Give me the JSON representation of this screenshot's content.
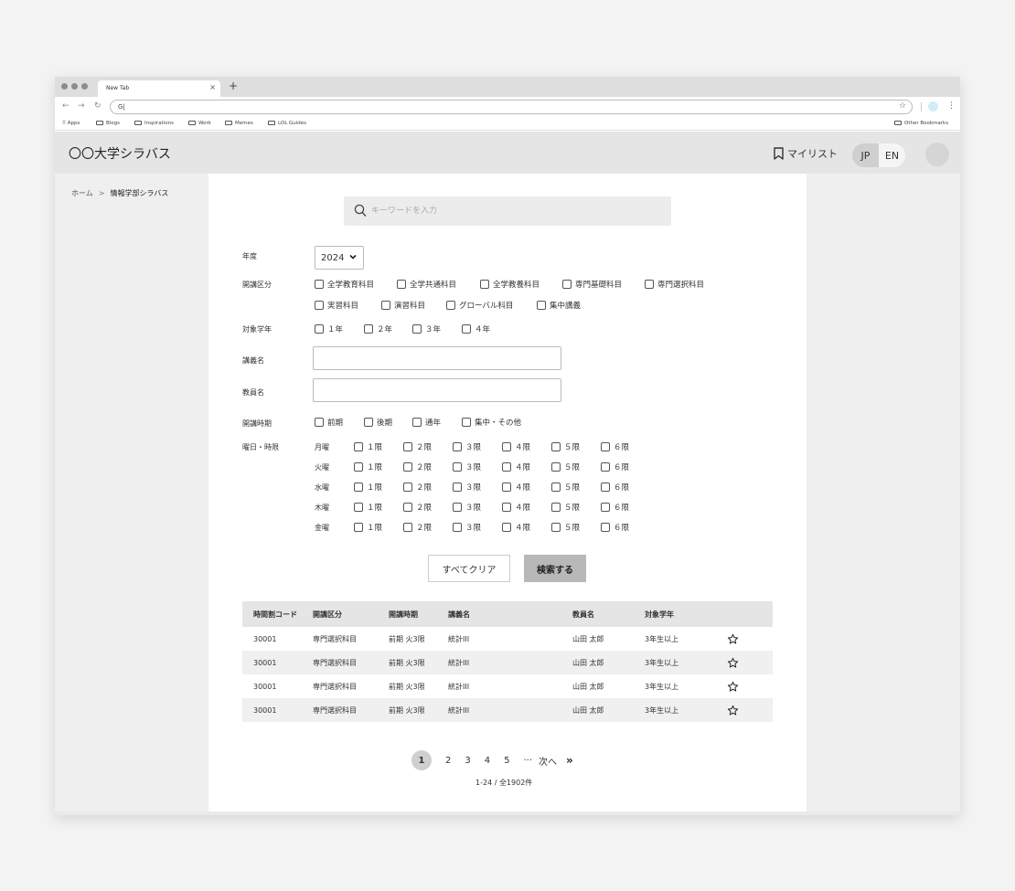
{
  "browser": {
    "tab_title": "New Tab",
    "tab_close": "×",
    "new_tab": "+",
    "url": "G|",
    "bookmarks": [
      "Apps",
      "Blogs",
      "Inspirations",
      "Work",
      "Memes",
      "LOL Guides"
    ],
    "other_bookmarks": "Other Bookmarks"
  },
  "header": {
    "site_title": "〇〇大学シラバス",
    "mylist_label": "マイリスト",
    "lang_jp": "JP",
    "lang_en": "EN"
  },
  "breadcrumb": {
    "home": "ホーム",
    "separator": ">",
    "current": "情報学部シラバス"
  },
  "search": {
    "placeholder": "キーワードを入力"
  },
  "filters": {
    "year_label": "年度",
    "year_value": "2024",
    "category_label": "開講区分",
    "categories": [
      "全学教育科目",
      "全学共通科目",
      "全学教養科目",
      "専門基礎科目",
      "専門選択科目",
      "実習科目",
      "演習科目",
      "グローバル科目",
      "集中講義"
    ],
    "grade_label": "対象学年",
    "grades": [
      "１年",
      "２年",
      "３年",
      "４年"
    ],
    "course_name_label": "講義名",
    "instructor_label": "教員名",
    "term_label": "開講時期",
    "terms": [
      "前期",
      "後期",
      "通年",
      "集中・その他"
    ],
    "dayperiod_label": "曜日・時限",
    "days": [
      "月曜",
      "火曜",
      "水曜",
      "木曜",
      "金曜"
    ],
    "periods": [
      "１限",
      "２限",
      "３限",
      "４限",
      "５限",
      "６限"
    ]
  },
  "actions": {
    "clear": "すべてクリア",
    "search": "検索する"
  },
  "results": {
    "columns": [
      "時間割コード",
      "開講区分",
      "開講時期",
      "講義名",
      "教員名",
      "対象学年"
    ],
    "rows": [
      [
        "30001",
        "専門選択科目",
        "前期 火3限",
        "統計III",
        "山田 太郎",
        "3年生以上"
      ],
      [
        "30001",
        "専門選択科目",
        "前期 火3限",
        "統計III",
        "山田 太郎",
        "3年生以上"
      ],
      [
        "30001",
        "専門選択科目",
        "前期 火3限",
        "統計III",
        "山田 太郎",
        "3年生以上"
      ],
      [
        "30001",
        "専門選択科目",
        "前期 火3限",
        "統計III",
        "山田 太郎",
        "3年生以上"
      ]
    ]
  },
  "pagination": {
    "pages": [
      "1",
      "2",
      "3",
      "4",
      "5"
    ],
    "ellipsis": "···",
    "next": "次へ",
    "last": "»",
    "summary": "1-24 / 全1902件"
  }
}
